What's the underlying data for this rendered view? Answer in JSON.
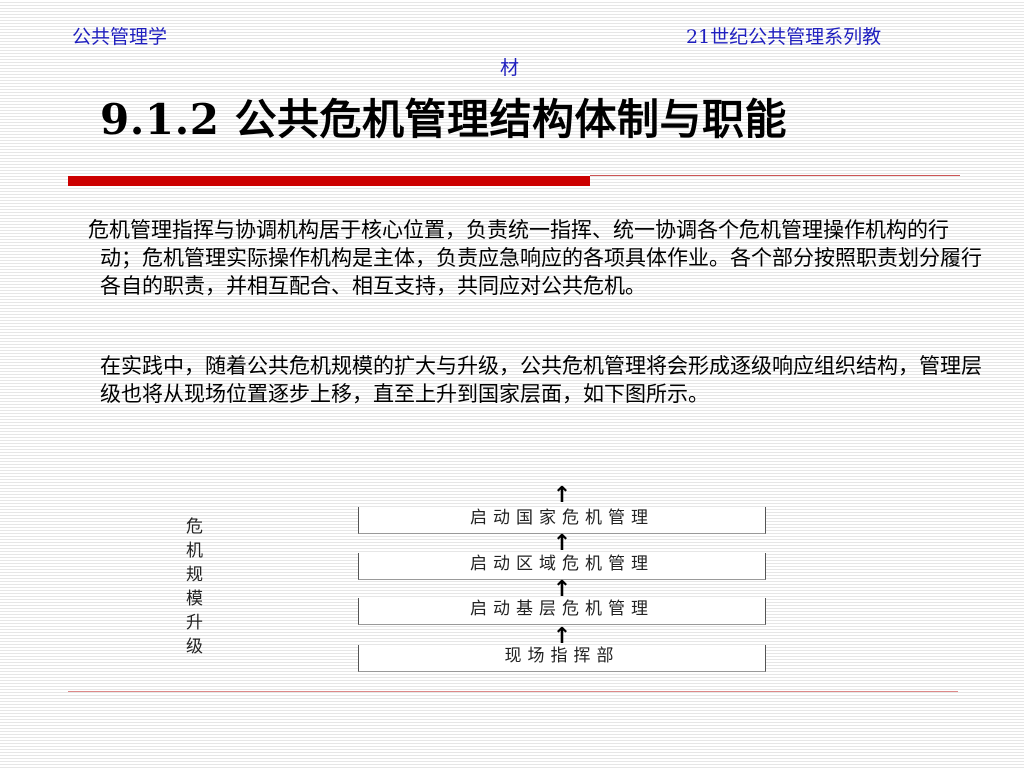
{
  "header": {
    "left": "公共管理学",
    "right": "21世纪公共管理系列教",
    "right_wrap": "材"
  },
  "title": "9.1.2  公共危机管理结构体制与职能",
  "paragraphs": [
    "危机管理指挥与协调机构居于核心位置，负责统一指挥、统一协调各个危机管理操作机构的行动；危机管理实际操作机构是主体，负责应急响应的各项具体作业。各个部分按照职责划分履行各自的职责，并相互配合、相互支持，共同应对公共危机。",
    "在实践中，随着公共危机规模的扩大与升级，公共危机管理将会形成逐级响应组织结构，管理层级也将从现场位置逐步上移，直至上升到国家层面，如下图所示。"
  ],
  "diagram": {
    "side_label": [
      "危",
      "机",
      "规",
      "模",
      "升",
      "级"
    ],
    "levels": [
      "启动国家危机管理",
      "启动区域危机管理",
      "启动基层危机管理",
      "现场指挥部"
    ],
    "arrow_glyph": "↑"
  },
  "colors": {
    "header_text": "#1f1fbf",
    "accent_rule": "#cc0000"
  }
}
